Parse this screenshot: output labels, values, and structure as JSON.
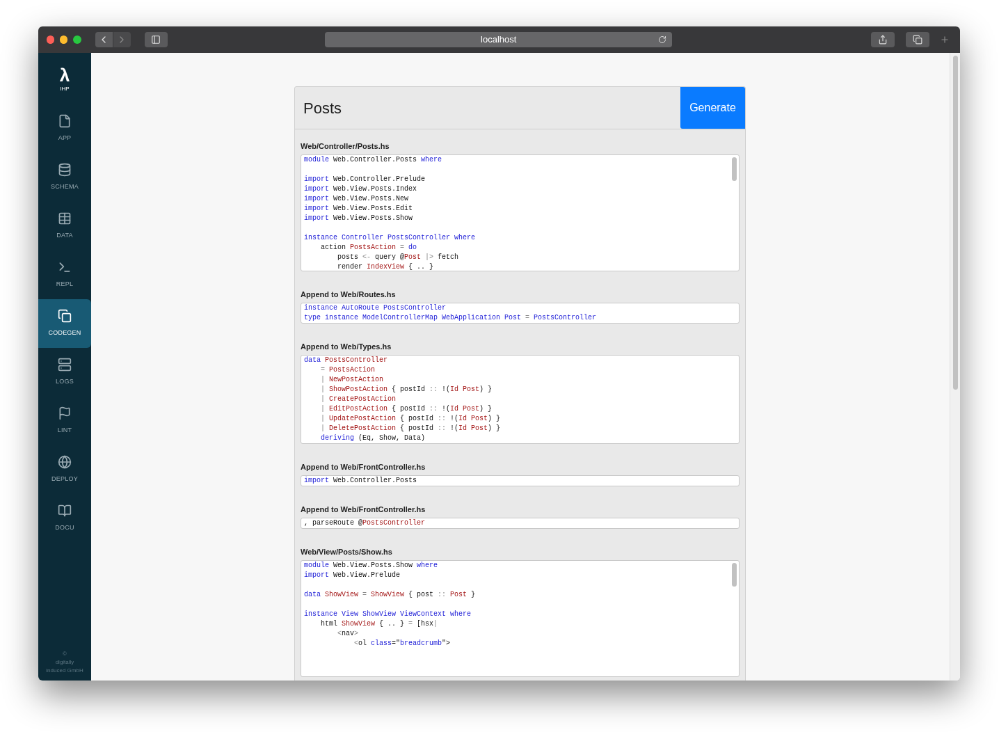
{
  "browser": {
    "address": "localhost"
  },
  "sidebar": {
    "logo": "λ",
    "logo_label": "IHP",
    "items": [
      {
        "label": "APP",
        "selected": false
      },
      {
        "label": "SCHEMA",
        "selected": false
      },
      {
        "label": "DATA",
        "selected": false
      },
      {
        "label": "REPL",
        "selected": false
      },
      {
        "label": "CODEGEN",
        "selected": true
      },
      {
        "label": "LOGS",
        "selected": false
      },
      {
        "label": "LINT",
        "selected": false
      },
      {
        "label": "DEPLOY",
        "selected": false
      },
      {
        "label": "DOCU",
        "selected": false
      }
    ],
    "footer": [
      "©",
      "digitally",
      "induced GmbH"
    ]
  },
  "card": {
    "title": "Posts",
    "button": "Generate",
    "files": [
      {
        "label": "Web/Controller/Posts.hs",
        "scroll": true,
        "lines": [
          {
            "tokens": [
              {
                "kind": "kw",
                "t": "module"
              },
              {
                "kind": "plain",
                "t": " Web.Controller.Posts "
              },
              {
                "kind": "kw",
                "t": "where"
              }
            ]
          },
          {
            "kind": "blank"
          },
          {
            "tokens": [
              {
                "kind": "kw",
                "t": "import"
              },
              {
                "kind": "plain",
                "t": " Web.Controller.Prelude"
              }
            ]
          },
          {
            "tokens": [
              {
                "kind": "kw",
                "t": "import"
              },
              {
                "kind": "plain",
                "t": " Web.View.Posts.Index"
              }
            ]
          },
          {
            "tokens": [
              {
                "kind": "kw",
                "t": "import"
              },
              {
                "kind": "plain",
                "t": " Web.View.Posts.New"
              }
            ]
          },
          {
            "tokens": [
              {
                "kind": "kw",
                "t": "import"
              },
              {
                "kind": "plain",
                "t": " Web.View.Posts.Edit"
              }
            ]
          },
          {
            "tokens": [
              {
                "kind": "kw",
                "t": "import"
              },
              {
                "kind": "plain",
                "t": " Web.View.Posts.Show"
              }
            ]
          },
          {
            "kind": "blank"
          },
          {
            "tokens": [
              {
                "kind": "kw",
                "t": "instance Controller PostsController where"
              }
            ]
          },
          {
            "tokens": [
              {
                "kind": "plain",
                "t": "    action "
              },
              {
                "kind": "ty",
                "t": "PostsAction"
              },
              {
                "kind": "op",
                "t": " = "
              },
              {
                "kind": "kw",
                "t": "do"
              }
            ]
          },
          {
            "tokens": [
              {
                "kind": "plain",
                "t": "        posts "
              },
              {
                "kind": "op",
                "t": "<-"
              },
              {
                "kind": "plain",
                "t": " query @"
              },
              {
                "kind": "ty",
                "t": "Post"
              },
              {
                "kind": "op",
                "t": " |> "
              },
              {
                "kind": "plain",
                "t": "fetch"
              }
            ]
          },
          {
            "tokens": [
              {
                "kind": "plain",
                "t": "        render "
              },
              {
                "kind": "ty",
                "t": "IndexView"
              },
              {
                "kind": "plain",
                "t": " { .. }"
              }
            ]
          }
        ]
      },
      {
        "label": "Append to Web/Routes.hs",
        "scroll": false,
        "lines": [
          {
            "tokens": [
              {
                "kind": "kw",
                "t": "instance AutoRoute PostsController"
              }
            ]
          },
          {
            "tokens": [
              {
                "kind": "kw",
                "t": "type instance ModelControllerMap WebApplication Post"
              },
              {
                "kind": "op",
                "t": " = "
              },
              {
                "kind": "kw",
                "t": "PostsController"
              }
            ]
          }
        ]
      },
      {
        "label": "Append to Web/Types.hs",
        "scroll": false,
        "lines": [
          {
            "tokens": [
              {
                "kind": "kw",
                "t": "data"
              },
              {
                "kind": "ty",
                "t": " PostsController"
              }
            ]
          },
          {
            "tokens": [
              {
                "kind": "op",
                "t": "    = "
              },
              {
                "kind": "ty",
                "t": "PostsAction"
              }
            ]
          },
          {
            "tokens": [
              {
                "kind": "op",
                "t": "    | "
              },
              {
                "kind": "ty",
                "t": "NewPostAction"
              }
            ]
          },
          {
            "tokens": [
              {
                "kind": "op",
                "t": "    | "
              },
              {
                "kind": "ty",
                "t": "ShowPostAction"
              },
              {
                "kind": "plain",
                "t": " { postId "
              },
              {
                "kind": "op",
                "t": "::"
              },
              {
                "kind": "plain",
                "t": " !("
              },
              {
                "kind": "ty",
                "t": "Id Post"
              },
              {
                "kind": "plain",
                "t": ") }"
              }
            ]
          },
          {
            "tokens": [
              {
                "kind": "op",
                "t": "    | "
              },
              {
                "kind": "ty",
                "t": "CreatePostAction"
              }
            ]
          },
          {
            "tokens": [
              {
                "kind": "op",
                "t": "    | "
              },
              {
                "kind": "ty",
                "t": "EditPostAction"
              },
              {
                "kind": "plain",
                "t": " { postId "
              },
              {
                "kind": "op",
                "t": "::"
              },
              {
                "kind": "plain",
                "t": " !("
              },
              {
                "kind": "ty",
                "t": "Id Post"
              },
              {
                "kind": "plain",
                "t": ") }"
              }
            ]
          },
          {
            "tokens": [
              {
                "kind": "op",
                "t": "    | "
              },
              {
                "kind": "ty",
                "t": "UpdatePostAction"
              },
              {
                "kind": "plain",
                "t": " { postId "
              },
              {
                "kind": "op",
                "t": "::"
              },
              {
                "kind": "plain",
                "t": " !("
              },
              {
                "kind": "ty",
                "t": "Id Post"
              },
              {
                "kind": "plain",
                "t": ") }"
              }
            ]
          },
          {
            "tokens": [
              {
                "kind": "op",
                "t": "    | "
              },
              {
                "kind": "ty",
                "t": "DeletePostAction"
              },
              {
                "kind": "plain",
                "t": " { postId "
              },
              {
                "kind": "op",
                "t": "::"
              },
              {
                "kind": "plain",
                "t": " !("
              },
              {
                "kind": "ty",
                "t": "Id Post"
              },
              {
                "kind": "plain",
                "t": ") }"
              }
            ]
          },
          {
            "tokens": [
              {
                "kind": "kw",
                "t": "    deriving"
              },
              {
                "kind": "plain",
                "t": " (Eq, Show, Data)"
              }
            ]
          }
        ]
      },
      {
        "label": "Append to Web/FrontController.hs",
        "scroll": false,
        "lines": [
          {
            "tokens": [
              {
                "kind": "kw",
                "t": "import"
              },
              {
                "kind": "plain",
                "t": " Web.Controller.Posts"
              }
            ]
          }
        ]
      },
      {
        "label": "Append to Web/FrontController.hs",
        "scroll": false,
        "lines": [
          {
            "tokens": [
              {
                "kind": "plain",
                "t": ", parseRoute @"
              },
              {
                "kind": "ty",
                "t": "PostsController"
              }
            ]
          }
        ]
      },
      {
        "label": "Web/View/Posts/Show.hs",
        "scroll": true,
        "lines": [
          {
            "tokens": [
              {
                "kind": "kw",
                "t": "module"
              },
              {
                "kind": "plain",
                "t": " Web.View.Posts.Show "
              },
              {
                "kind": "kw",
                "t": "where"
              }
            ]
          },
          {
            "tokens": [
              {
                "kind": "kw",
                "t": "import"
              },
              {
                "kind": "plain",
                "t": " Web.View.Prelude"
              }
            ]
          },
          {
            "kind": "blank"
          },
          {
            "tokens": [
              {
                "kind": "kw",
                "t": "data"
              },
              {
                "kind": "ty",
                "t": " ShowView"
              },
              {
                "kind": "op",
                "t": " = "
              },
              {
                "kind": "ty",
                "t": "ShowView"
              },
              {
                "kind": "plain",
                "t": " { post "
              },
              {
                "kind": "op",
                "t": "::"
              },
              {
                "kind": "ty",
                "t": " Post"
              },
              {
                "kind": "plain",
                "t": " }"
              }
            ]
          },
          {
            "kind": "blank"
          },
          {
            "tokens": [
              {
                "kind": "kw",
                "t": "instance View ShowView ViewContext where"
              }
            ]
          },
          {
            "tokens": [
              {
                "kind": "plain",
                "t": "    html "
              },
              {
                "kind": "ty",
                "t": "ShowView"
              },
              {
                "kind": "plain",
                "t": " { .. } "
              },
              {
                "kind": "op",
                "t": "="
              },
              {
                "kind": "plain",
                "t": " [hsx"
              },
              {
                "kind": "op",
                "t": "|"
              }
            ]
          },
          {
            "tokens": [
              {
                "kind": "op",
                "t": "        <"
              },
              {
                "kind": "plain",
                "t": "nav"
              },
              {
                "kind": "op",
                "t": ">"
              }
            ]
          },
          {
            "tokens": [
              {
                "kind": "op",
                "t": "            <"
              },
              {
                "kind": "plain",
                "t": "ol "
              },
              {
                "kind": "kw",
                "t": "class"
              },
              {
                "kind": "plain",
                "t": "=\""
              },
              {
                "kind": "kw",
                "t": "breadcrumb"
              },
              {
                "kind": "plain",
                "t": "\">"
              }
            ]
          }
        ]
      }
    ]
  }
}
